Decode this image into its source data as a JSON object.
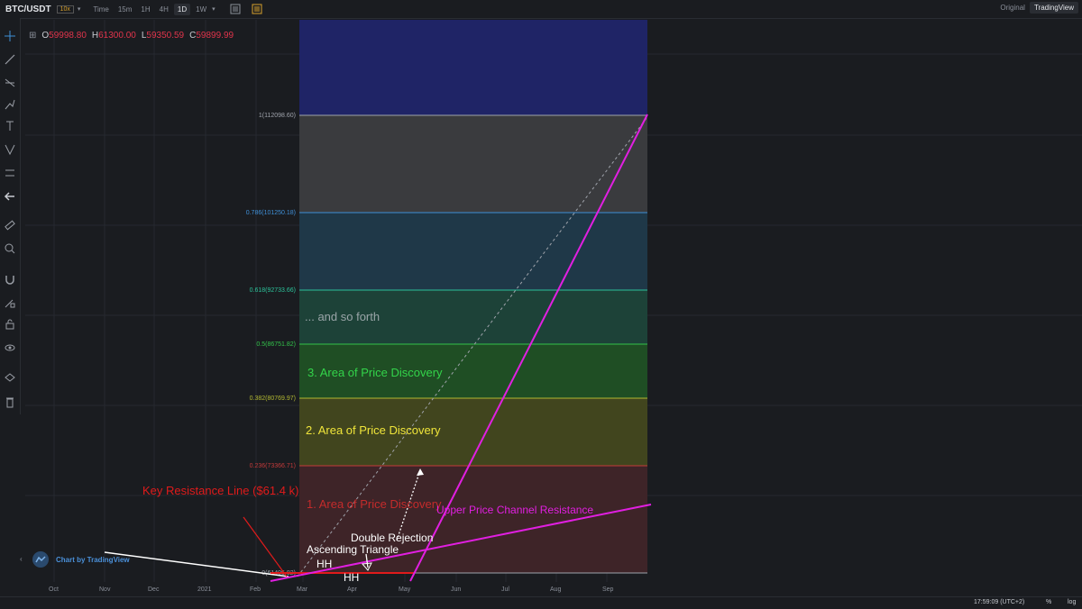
{
  "header": {
    "symbol": "BTC/USDT",
    "leverage": "10x",
    "timeframes": [
      "Time",
      "15m",
      "1H",
      "4H",
      "1D",
      "1W"
    ],
    "active_timeframe": "1D",
    "view_modes": [
      "Original",
      "TradingView"
    ],
    "active_view": "TradingView"
  },
  "ohlc": {
    "o_label": "O",
    "o_value": "59998.80",
    "h_label": "H",
    "h_value": "61300.00",
    "l_label": "L",
    "l_value": "59350.59",
    "c_label": "C",
    "c_value": "59899.99"
  },
  "fib_levels": [
    {
      "label": "1(112098.60)",
      "color": "#9fa3ab"
    },
    {
      "label": "0.786(101250.18)",
      "color": "#3f8fd6"
    },
    {
      "label": "0.618(92733.66)",
      "color": "#2cc29a"
    },
    {
      "label": "0.5(86751.82)",
      "color": "#33c24a"
    },
    {
      "label": "0.382(80769.97)",
      "color": "#b2b832"
    },
    {
      "label": "0.236(73366.71)",
      "color": "#c23a3a"
    },
    {
      "label": "0(61405.82)",
      "color": "#9fa3ab"
    }
  ],
  "annotations": {
    "so_forth": "... and so forth",
    "area3": "3. Area of Price Discovery",
    "area2": "2. Area of Price Discovery",
    "area1": "1. Area of Price Discovery",
    "key_resistance": "Key Resistance Line ($61.4 k)",
    "upper_channel": "Upper Price Channel Resistance",
    "double_rejection": "Double Rejection",
    "ascending_triangle": "Ascending Triangle",
    "hh": "HH",
    "hh2": "HH"
  },
  "xaxis": [
    "Oct",
    "Nov",
    "Dec",
    "2021",
    "Feb",
    "Mar",
    "Apr",
    "May",
    "Jun",
    "Jul",
    "Aug",
    "Sep"
  ],
  "branding": "Chart by TradingView",
  "footer": {
    "time": "17:59:09 (UTC+2)",
    "percent": "%",
    "log": "log"
  },
  "colors": {
    "background": "#1a1c20",
    "magenta": "#e11fe1",
    "red": "#e01b1b"
  }
}
